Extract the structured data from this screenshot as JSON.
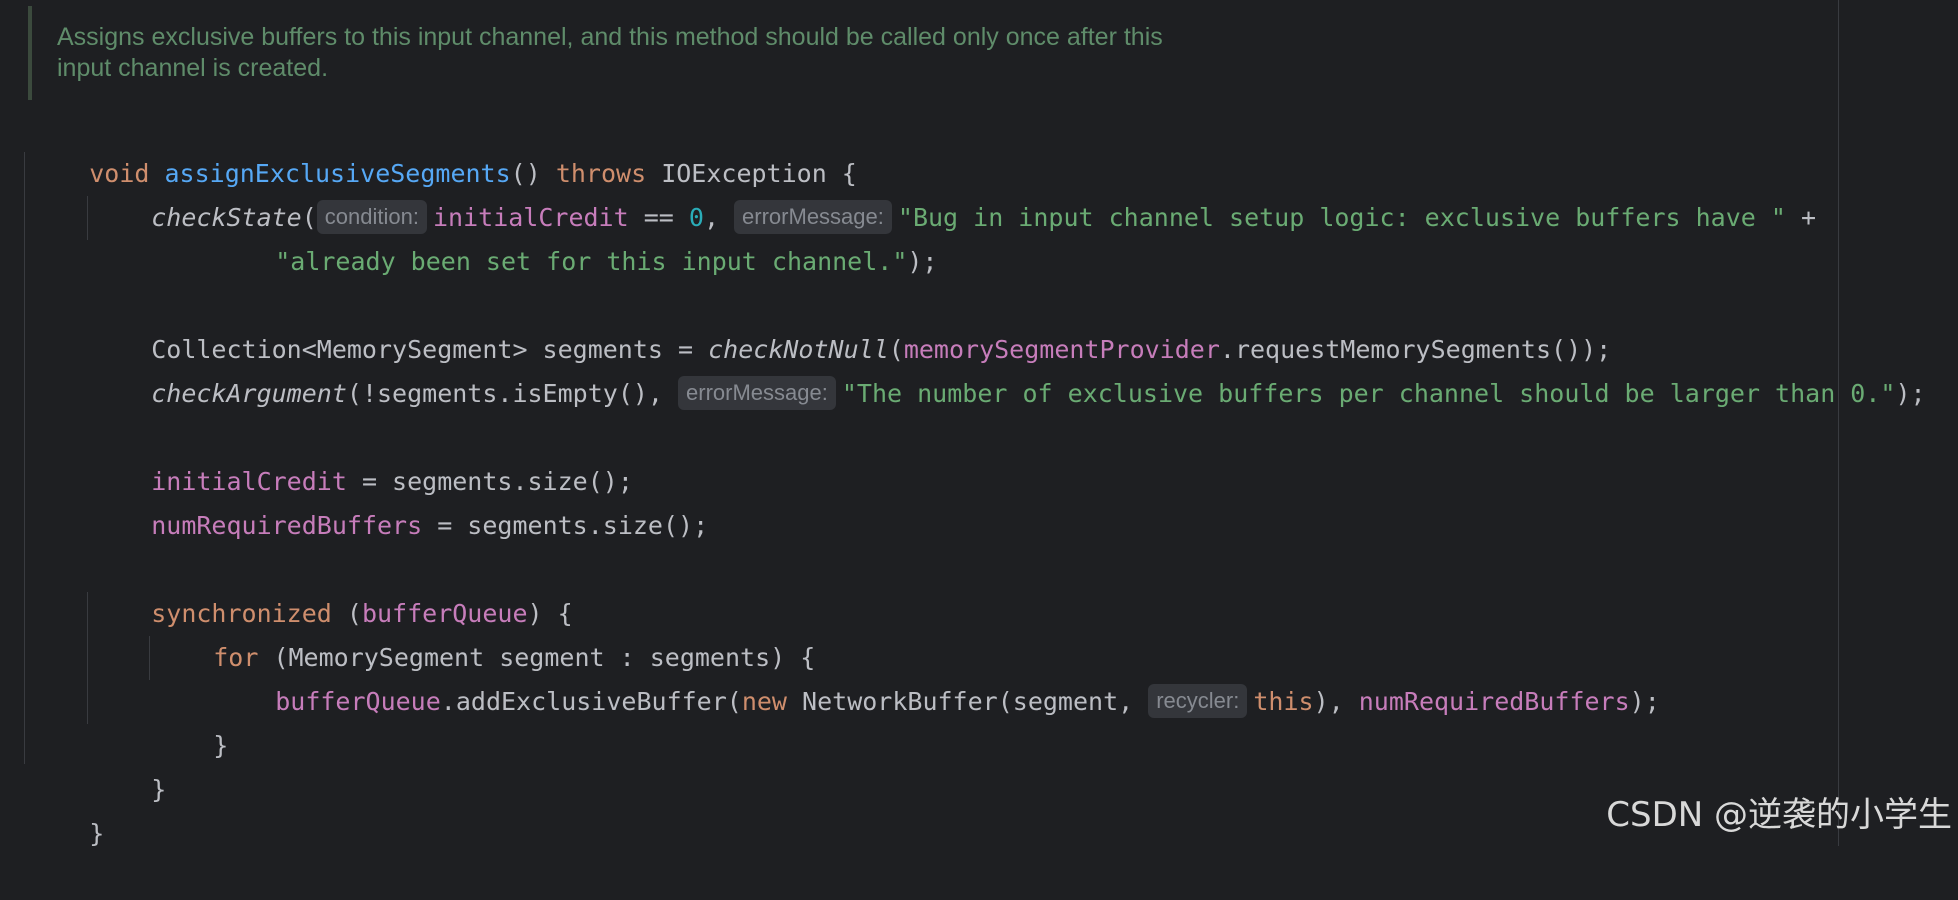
{
  "doc_comment": {
    "line1": "Assigns exclusive buffers to this input channel, and this method should be called only once after this",
    "line2": "input channel is created."
  },
  "code": {
    "l1": {
      "t1": "void ",
      "t2": "assignExclusiveSegments",
      "t3": "() ",
      "t4": "throws ",
      "t5": "IOException {"
    },
    "l2": {
      "t1": "checkState",
      "t2": "(",
      "hint": "condition:",
      "t3": "initialCredit",
      "t4": " == ",
      "t5": "0",
      "t6": ", ",
      "hint2": "errorMessage:",
      "t7": "\"Bug in input channel setup logic: exclusive buffers have \"",
      "t8": " +"
    },
    "l3": {
      "t1": "\"already been set for this input channel.\"",
      "t2": ");"
    },
    "l4": {
      "t1": "Collection<MemorySegment> segments = ",
      "t2": "checkNotNull",
      "t3": "(",
      "t4": "memorySegmentProvider",
      "t5": ".requestMemorySegments());"
    },
    "l5": {
      "t1": "checkArgument",
      "t2": "(!segments.isEmpty(), ",
      "hint": "errorMessage:",
      "t3": "\"The number of exclusive buffers per channel should be larger than 0.\"",
      "t4": ");"
    },
    "l6": {
      "t1": "initialCredit",
      "t2": " = segments.size();"
    },
    "l7": {
      "t1": "numRequiredBuffers",
      "t2": " = segments.size();"
    },
    "l8": {
      "t1": "synchronized ",
      "t2": "(",
      "t3": "bufferQueue",
      "t4": ") {"
    },
    "l9": {
      "t1": "for ",
      "t2": "(MemorySegment segment : segments) {"
    },
    "l10": {
      "t1": "bufferQueue",
      "t2": ".addExclusiveBuffer(",
      "t3": "new ",
      "t4": "NetworkBuffer(segment, ",
      "hint": "recycler:",
      "t5": "this",
      "t6": "), ",
      "t7": "numRequiredBuffers",
      "t8": ");"
    },
    "l11": {
      "t1": "}"
    },
    "l12": {
      "t1": "}"
    },
    "l13": {
      "t1": "}"
    }
  },
  "watermark": "CSDN @逆袭的小学生",
  "colors": {
    "background": "#1e1f22",
    "keyword": "#cf8e6d",
    "function": "#56a8f5",
    "field": "#c77dbb",
    "string": "#6aab73",
    "number": "#2aacb8",
    "comment": "#5f8c6a",
    "text": "#bcbec4"
  }
}
